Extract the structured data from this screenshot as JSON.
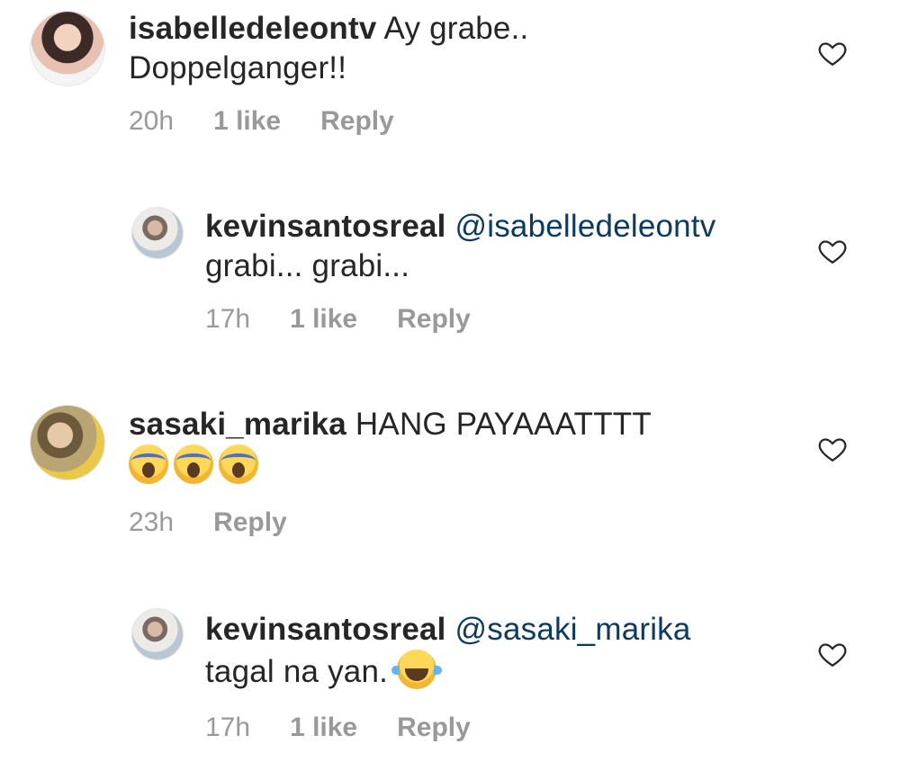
{
  "comments": [
    {
      "username": "isabelledeleontv",
      "text_line1": "Ay grabe..",
      "text_line2": "Doppelganger!!",
      "time": "20h",
      "likes": "1 like",
      "reply": "Reply"
    },
    {
      "username": "kevinsantosreal",
      "mention": "@isabelledeleontv",
      "text_line2": "grabi... grabi...",
      "time": "17h",
      "likes": "1 like",
      "reply": "Reply"
    },
    {
      "username": "sasaki_marika",
      "text_line1": "HANG PAYAAATTTT",
      "emoji": [
        "scream",
        "scream",
        "scream"
      ],
      "time": "23h",
      "reply": "Reply"
    },
    {
      "username": "kevinsantosreal",
      "mention": "@sasaki_marika",
      "text_line2": "tagal na yan.",
      "emoji": [
        "laugh"
      ],
      "time": "17h",
      "likes": "1 like",
      "reply": "Reply"
    }
  ],
  "icons": {
    "like": "heart-outline-icon"
  },
  "colors": {
    "mention": "#0b3b60",
    "meta": "#999999",
    "text": "#262626"
  }
}
